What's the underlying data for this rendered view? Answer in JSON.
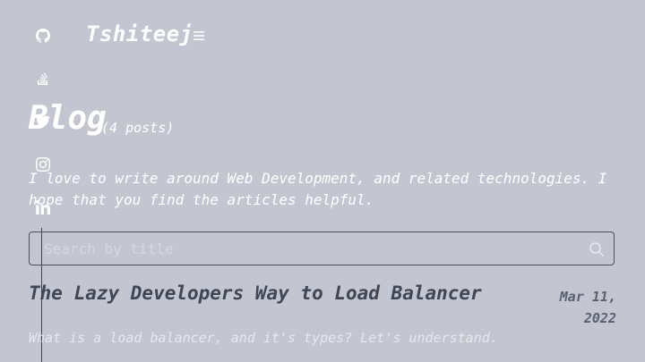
{
  "site": {
    "brand": "Tshiteej"
  },
  "social": {
    "icons": [
      "github-icon",
      "stackoverflow-icon",
      "twitter-icon",
      "instagram-icon",
      "linkedin-icon"
    ]
  },
  "page": {
    "title": "Blog",
    "count": "(4 posts)",
    "description": "I love to write around Web Development, and related technologies. I hope that you find the articles helpful."
  },
  "search": {
    "placeholder": "Search by title",
    "value": ""
  },
  "posts": [
    {
      "title": "The Lazy Developers Way to Load Balancer",
      "date_line1": "Mar 11,",
      "date_line2": "2022",
      "summary": "What is a load balancer, and it's types? Let's understand."
    }
  ],
  "colors": {
    "background": "#c3c6d0",
    "text_dark": "#3f4655",
    "text_light": "#ffffff"
  }
}
